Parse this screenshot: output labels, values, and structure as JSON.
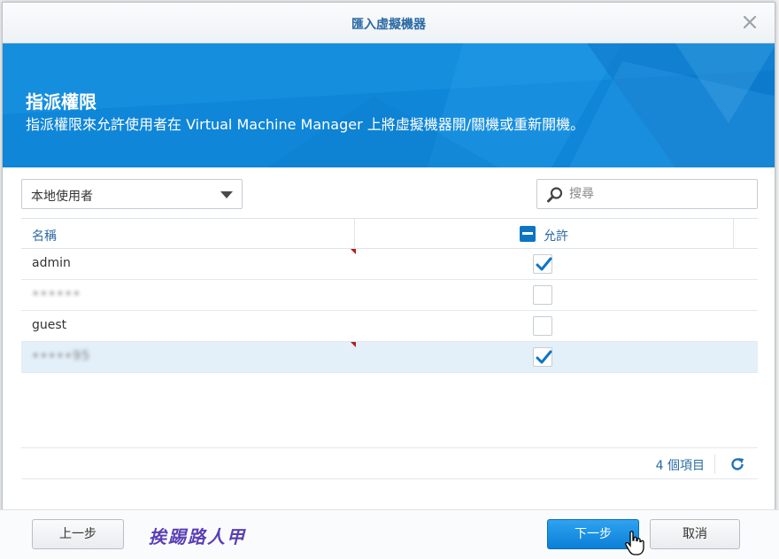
{
  "dialog": {
    "title": "匯入虛擬機器"
  },
  "banner": {
    "heading": "指派權限",
    "description": "指派權限來允許使用者在 Virtual Machine Manager 上將虛擬機器開/關機或重新開機。"
  },
  "toolbar": {
    "user_type": "本地使用者",
    "search_placeholder": "搜尋"
  },
  "grid": {
    "columns": [
      "名稱",
      "允許"
    ],
    "rows": [
      {
        "name": "admin",
        "allowed": true,
        "blurred": false,
        "selected": false,
        "flag": true
      },
      {
        "name": "••••••",
        "allowed": false,
        "blurred": true,
        "selected": false,
        "flag": false
      },
      {
        "name": "guest",
        "allowed": false,
        "blurred": false,
        "selected": false,
        "flag": false
      },
      {
        "name": "•••••95",
        "allowed": true,
        "blurred": true,
        "selected": true,
        "flag": true
      }
    ],
    "count_text": "4 個項目"
  },
  "footer": {
    "prev_label": "上一步",
    "next_label": "下一步",
    "cancel_label": "取消",
    "watermark": "挨踢路人甲"
  },
  "colors": {
    "accent": "#0d75c4",
    "banner": "#0f86d8",
    "link": "#2b6aa3"
  }
}
